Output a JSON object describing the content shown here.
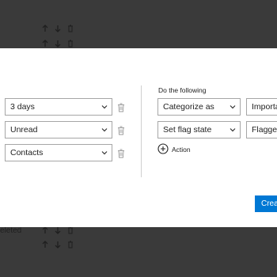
{
  "background": {
    "partial_text": "eleted"
  },
  "conditions": {
    "rows": [
      {
        "value": "3 days"
      },
      {
        "value": "Unread"
      },
      {
        "value": "Contacts"
      }
    ]
  },
  "actions": {
    "heading": "Do the following",
    "rows": [
      {
        "action": "Categorize as",
        "value": "Importa"
      },
      {
        "action": "Set flag state",
        "value": "Flagged"
      }
    ],
    "add_action_label": "Action"
  },
  "footer": {
    "create_label": "Crea"
  },
  "colors": {
    "overlay": "#3a3a3a",
    "accent": "#0078d4",
    "border": "#a6a6a6"
  }
}
